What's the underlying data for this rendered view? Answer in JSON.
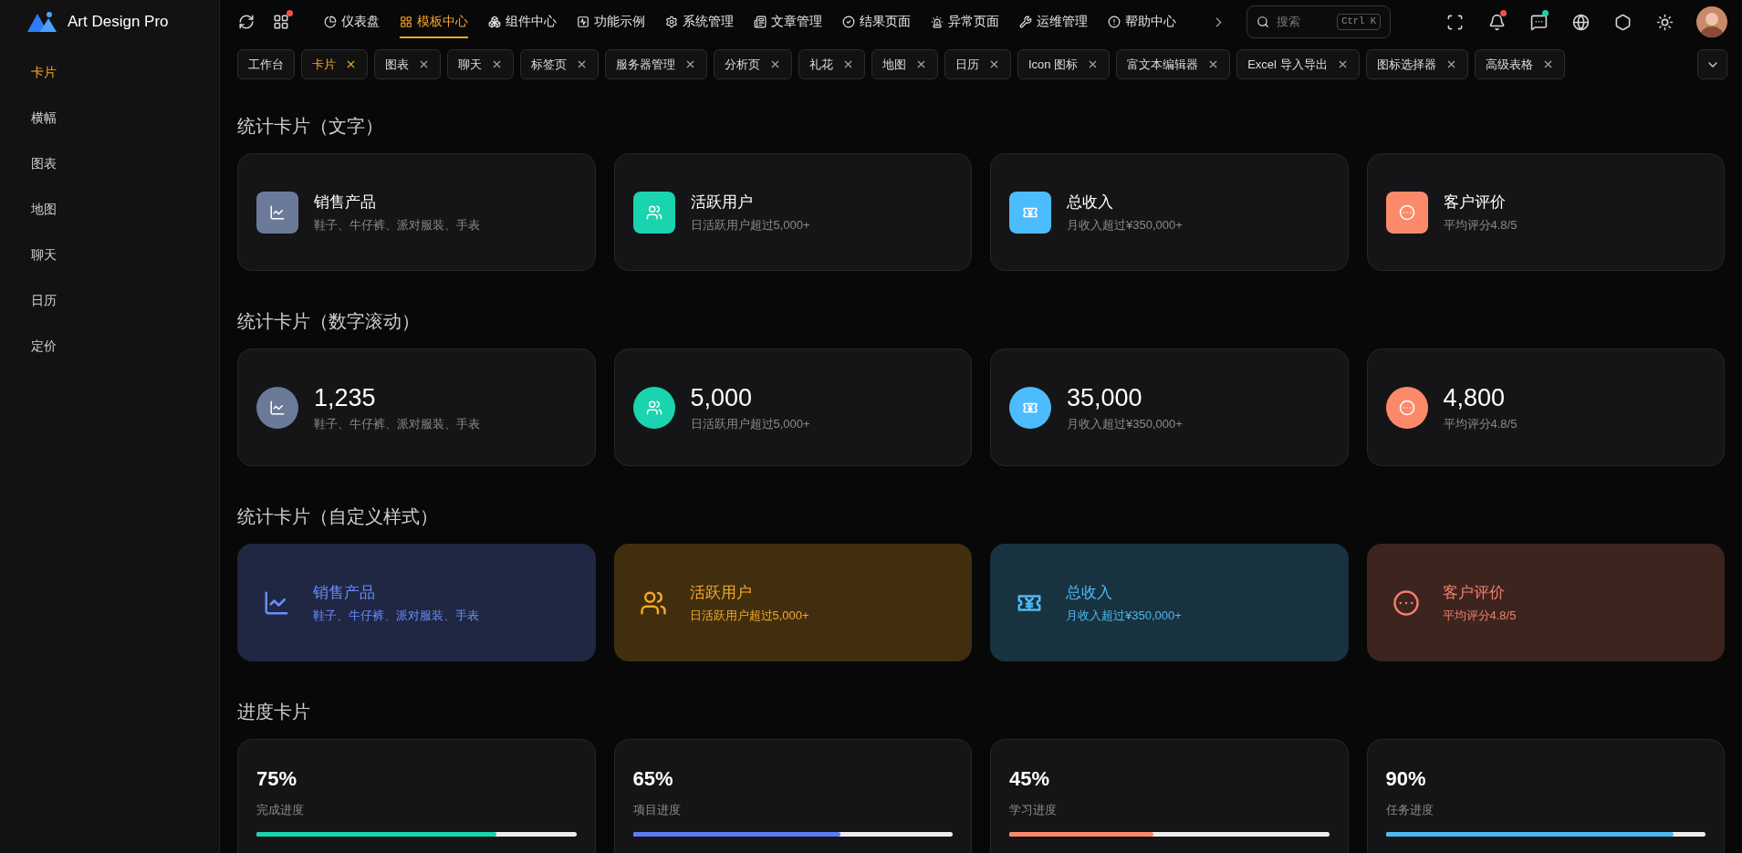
{
  "app": {
    "name": "Art Design Pro"
  },
  "sidebar": {
    "items": [
      {
        "label": "卡片",
        "selected": true
      },
      {
        "label": "横幅",
        "selected": false
      },
      {
        "label": "图表",
        "selected": false
      },
      {
        "label": "地图",
        "selected": false
      },
      {
        "label": "聊天",
        "selected": false
      },
      {
        "label": "日历",
        "selected": false
      },
      {
        "label": "定价",
        "selected": false
      }
    ]
  },
  "header": {
    "apps_notification": true,
    "menu": [
      {
        "label": "仪表盘",
        "selected": false
      },
      {
        "label": "模板中心",
        "selected": true
      },
      {
        "label": "组件中心",
        "selected": false
      },
      {
        "label": "功能示例",
        "selected": false
      },
      {
        "label": "系统管理",
        "selected": false
      },
      {
        "label": "文章管理",
        "selected": false
      },
      {
        "label": "结果页面",
        "selected": false
      },
      {
        "label": "异常页面",
        "selected": false
      },
      {
        "label": "运维管理",
        "selected": false
      },
      {
        "label": "帮助中心",
        "selected": false
      }
    ],
    "search": {
      "placeholder": "搜索",
      "shortcut": "Ctrl K"
    },
    "icons": [
      {
        "kind": "fullscreen"
      },
      {
        "kind": "bell",
        "notification": true
      },
      {
        "kind": "chat",
        "notification": true
      },
      {
        "kind": "globe"
      },
      {
        "kind": "settings"
      },
      {
        "kind": "sun"
      },
      {
        "kind": "avatar"
      }
    ]
  },
  "tabs": [
    {
      "label": "工作台",
      "selected": false,
      "closable": false
    },
    {
      "label": "卡片",
      "selected": true,
      "closable": true
    },
    {
      "label": "图表",
      "selected": false,
      "closable": true
    },
    {
      "label": "聊天",
      "selected": false,
      "closable": true
    },
    {
      "label": "标签页",
      "selected": false,
      "closable": true
    },
    {
      "label": "服务器管理",
      "selected": false,
      "closable": true
    },
    {
      "label": "分析页",
      "selected": false,
      "closable": true
    },
    {
      "label": "礼花",
      "selected": false,
      "closable": true
    },
    {
      "label": "地图",
      "selected": false,
      "closable": true
    },
    {
      "label": "日历",
      "selected": false,
      "closable": true
    },
    {
      "label": "Icon 图标",
      "selected": false,
      "closable": true
    },
    {
      "label": "富文本编辑器",
      "selected": false,
      "closable": true
    },
    {
      "label": "Excel 导入导出",
      "selected": false,
      "closable": true
    },
    {
      "label": "图标选择器",
      "selected": false,
      "closable": true
    },
    {
      "label": "高级表格",
      "selected": false,
      "closable": true
    }
  ],
  "sections": [
    {
      "title": "统计卡片（文字）",
      "kind": "text",
      "cards": [
        {
          "title": "销售产品",
          "subtitle": "鞋子、牛仔裤、派对服装、手表",
          "color": "#6b7a99"
        },
        {
          "title": "活跃用户",
          "subtitle": "日活跃用户超过5,000+",
          "color": "#19d4ae"
        },
        {
          "title": "总收入",
          "subtitle": "月收入超过¥350,000+",
          "color": "#4cbcff"
        },
        {
          "title": "客户评价",
          "subtitle": "平均评分4.8/5",
          "color": "#fc8a6a"
        }
      ]
    },
    {
      "title": "统计卡片（数字滚动）",
      "kind": "number",
      "cards": [
        {
          "value": "1,235",
          "subtitle": "鞋子、牛仔裤、派对服装、手表",
          "color": "#6b7a99"
        },
        {
          "value": "5,000",
          "subtitle": "日活跃用户超过5,000+",
          "color": "#19d4ae"
        },
        {
          "value": "35,000",
          "subtitle": "月收入超过¥350,000+",
          "color": "#4cbcff"
        },
        {
          "value": "4,800",
          "subtitle": "平均评分4.8/5",
          "color": "#fc8a6a"
        }
      ]
    },
    {
      "title": "统计卡片（自定义样式）",
      "kind": "custom",
      "cards": [
        {
          "title": "销售产品",
          "subtitle": "鞋子、牛仔裤、派对服装、手表",
          "color": "#6b8cff"
        },
        {
          "title": "活跃用户",
          "subtitle": "日活跃用户超过5,000+",
          "color": "#f7a928"
        },
        {
          "title": "总收入",
          "subtitle": "月收入超过¥350,000+",
          "color": "#4cb9f2"
        },
        {
          "title": "客户评价",
          "subtitle": "平均评分4.8/5",
          "color": "#f07f6c"
        }
      ]
    },
    {
      "title": "进度卡片",
      "kind": "progress",
      "cards": [
        {
          "value": "75%",
          "label": "完成进度",
          "level": 0.75,
          "color": "#19d4ae"
        },
        {
          "value": "65%",
          "label": "项目进度",
          "level": 0.65,
          "color": "#5b7cf5"
        },
        {
          "value": "45%",
          "label": "学习进度",
          "level": 0.45,
          "color": "#fc8a6a"
        },
        {
          "value": "90%",
          "label": "任务进度",
          "level": 0.9,
          "color": "#4cb9f2"
        }
      ]
    }
  ]
}
